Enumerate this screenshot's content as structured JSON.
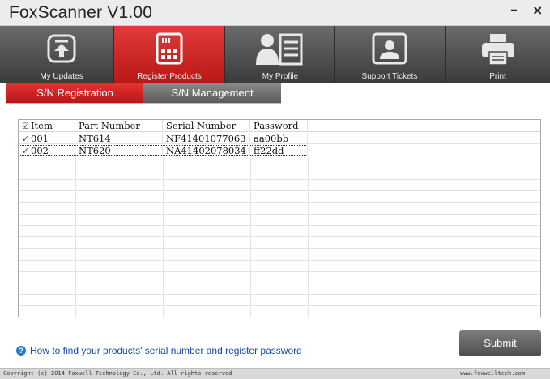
{
  "window": {
    "title": "FoxScanner  V1.00",
    "minimize_glyph": "–",
    "close_glyph": "×"
  },
  "toolbar": {
    "items": [
      {
        "label": "My Updates",
        "icon": "upload-icon",
        "active": false
      },
      {
        "label": "Register Products",
        "icon": "register-icon",
        "active": true
      },
      {
        "label": "My Profile",
        "icon": "profile-icon",
        "active": false
      },
      {
        "label": "Support Tickets",
        "icon": "support-icon",
        "active": false
      },
      {
        "label": "Print",
        "icon": "printer-icon",
        "active": false
      }
    ]
  },
  "tabs": [
    {
      "label": "S/N Registration",
      "active": true
    },
    {
      "label": "S/N Management",
      "active": false
    }
  ],
  "table": {
    "columns": [
      "Item",
      "Part Number",
      "Serial Number",
      "Password"
    ],
    "header_checked": true,
    "rows": [
      {
        "checked": true,
        "item": "001",
        "part": "NT614",
        "serial": "NF41401077063",
        "password": "aa00bb"
      },
      {
        "checked": true,
        "item": "002",
        "part": "NT620",
        "serial": "NA41402078034",
        "password": "ff22dd"
      }
    ]
  },
  "help_link": "How to find your products' serial number and register password",
  "submit_label": "Submit",
  "footer": {
    "copyright": "Copyright (c) 2014 Foxwell Technology Co., Ltd. All rights reserved",
    "website": "www.foxwelltech.com"
  },
  "colors": {
    "accent_red": "#c81e1e",
    "toolbar_gray": "#4a4a4a",
    "link_blue": "#1a47a8",
    "checkbox_blue": "#1f4fa5"
  }
}
